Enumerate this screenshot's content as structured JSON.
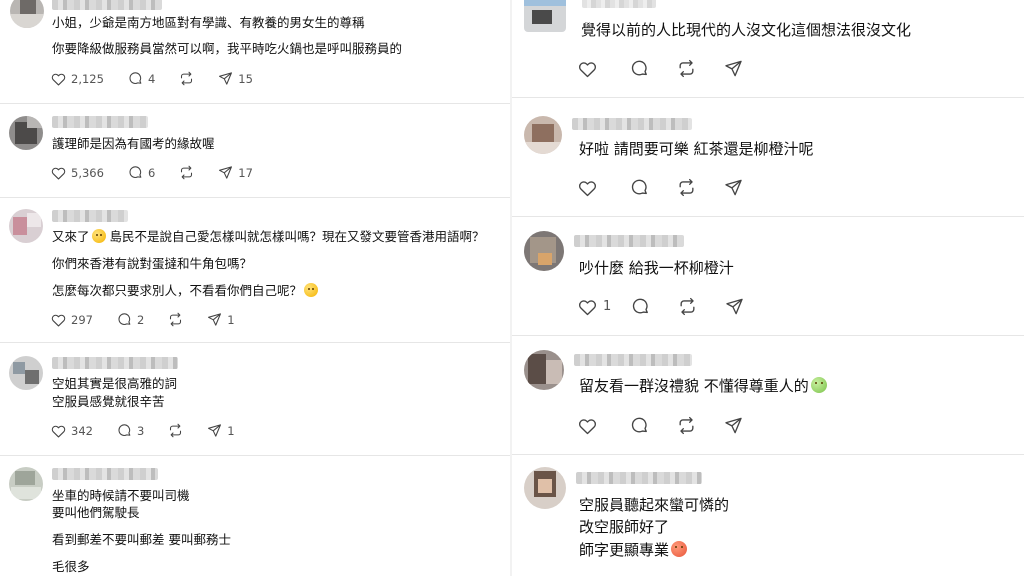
{
  "left_posts": [
    {
      "lines": [
        "小姐，少爺是南方地區對有學識、有教養的男女生的尊稱",
        "你要降級做服務員當然可以啊，我平時吃火鍋也是呼叫服務員的"
      ],
      "likes": "2,125",
      "comments": "4",
      "reposts": "",
      "shares": "15"
    },
    {
      "lines": [
        "護理師是因為有國考的緣故喔"
      ],
      "likes": "5,366",
      "comments": "6",
      "reposts": "",
      "shares": "17"
    },
    {
      "lines": [
        "又來了",
        "島民不是說自己愛怎樣叫就怎樣叫嗎？現在又發文要管香港用語啊？",
        "你們來香港有說對蛋撻和牛角包嗎？",
        "怎麼每次都只要求別人，不看看你們自己呢？"
      ],
      "likes": "297",
      "comments": "2",
      "reposts": "",
      "shares": "1"
    },
    {
      "lines": [
        "空姐其實是很高雅的詞",
        "空服員感覺就很辛苦"
      ],
      "likes": "342",
      "comments": "3",
      "reposts": "",
      "shares": "1"
    },
    {
      "lines": [
        "坐車的時候請不要叫司機",
        "要叫他們駕駛長",
        "看到郵差不要叫郵差 要叫郵務士",
        "毛很多"
      ]
    }
  ],
  "right_posts": [
    {
      "lines": [
        "覺得以前的人比現代的人沒文化這個想法很沒文化"
      ],
      "likes": ""
    },
    {
      "lines": [
        "好啦 請問要可樂 紅茶還是柳橙汁呢"
      ],
      "likes": ""
    },
    {
      "lines": [
        "吵什麼 給我一杯柳橙汁"
      ],
      "likes": "1"
    },
    {
      "lines": [
        "留友看一群沒禮貌 不懂得尊重人的"
      ],
      "likes": ""
    },
    {
      "lines": [
        "空服員聽起來蠻可憐的",
        "改空服師好了",
        "師字更顯專業"
      ]
    }
  ],
  "icons": {
    "like": "heart-icon",
    "comment": "comment-bubble-icon",
    "repost": "repost-icon",
    "share": "send-icon"
  },
  "colors": {
    "text": "#111111",
    "icon": "#444444",
    "divider": "#e6e6e6"
  }
}
